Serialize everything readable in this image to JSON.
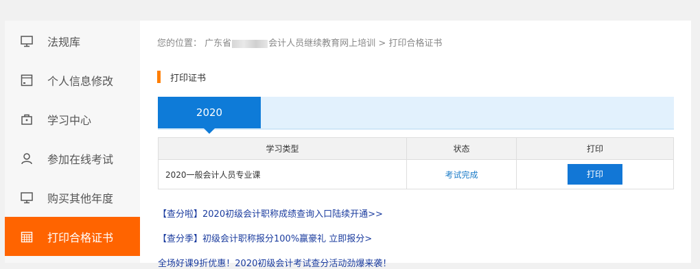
{
  "sidebar": {
    "items": [
      {
        "label": "法规库",
        "icon": "monitor-icon"
      },
      {
        "label": "个人信息修改",
        "icon": "form-icon"
      },
      {
        "label": "学习中心",
        "icon": "bag-icon"
      },
      {
        "label": "参加在线考试",
        "icon": "user-icon"
      },
      {
        "label": "购买其他年度",
        "icon": "monitor-icon"
      },
      {
        "label": "打印合格证书",
        "icon": "calendar-icon",
        "active": true
      }
    ]
  },
  "breadcrumb": {
    "prefix": "您的位置：",
    "region": "广东省",
    "site": "会计人员继续教育网上培训",
    "separator": ">",
    "current": "打印合格证书"
  },
  "section": {
    "title": "打印证书"
  },
  "year_tab": {
    "label": "2020"
  },
  "table": {
    "headers": [
      "学习类型",
      "状态",
      "打印"
    ],
    "rows": [
      {
        "type": "2020一般会计人员专业课",
        "status": "考试完成",
        "action": "打印"
      }
    ]
  },
  "links": [
    "【查分啦】2020初级会计职称成绩查询入口陆续开通>>",
    "【查分季】初级会计职称报分100%赢豪礼 立即报分>",
    "全场好课9折优惠！2020初级会计考试查分活动劲爆来袭！"
  ],
  "colors": {
    "accent_orange": "#ff6400",
    "primary_blue": "#0e7bd8",
    "link_blue": "#1a3b9e",
    "status_blue": "#1a7bc7"
  }
}
